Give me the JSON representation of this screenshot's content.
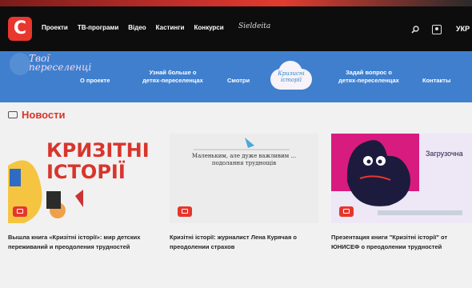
{
  "topbar": {
    "logo": "C",
    "nav": [
      "Проекти",
      "ТВ-програми",
      "Відео",
      "Кастинги",
      "Конкурси"
    ],
    "script_label": "Sieldeita",
    "lang": "УКР"
  },
  "subbar": {
    "brand_logo": "Твої переселенці",
    "links": [
      "О проекте",
      "Узнай больше о детях-переселенцах",
      "Смотри",
      "Задай вопрос о детях-переселенцах",
      "Контакты"
    ],
    "cloud_badge": "Кризисні історії"
  },
  "section": {
    "title": "Новости"
  },
  "cards": [
    {
      "image_text": "КРИЗІТНІ ІСТОРІЇ",
      "caption": "Вышла книга «Кризітні історії»: мир детских переживаний и преодоления трудностей"
    },
    {
      "image_text": "Маленьким, але дуже важливим ... подолання труднощів",
      "caption": "Кризітні історії: журналист Лена Курячая о преодолении страхов"
    },
    {
      "image_text": "Загрузочна",
      "caption": "Презентация книги \"Кризітні історії\" от ЮНИСЕФ о преодолении трудностей"
    }
  ],
  "colors": {
    "brand_red": "#e8372e",
    "subbar_blue": "#3f7fce",
    "section_red": "#d8352c"
  },
  "icons": [
    "search-icon",
    "profile-icon",
    "news-icon",
    "video-badge-icon"
  ]
}
